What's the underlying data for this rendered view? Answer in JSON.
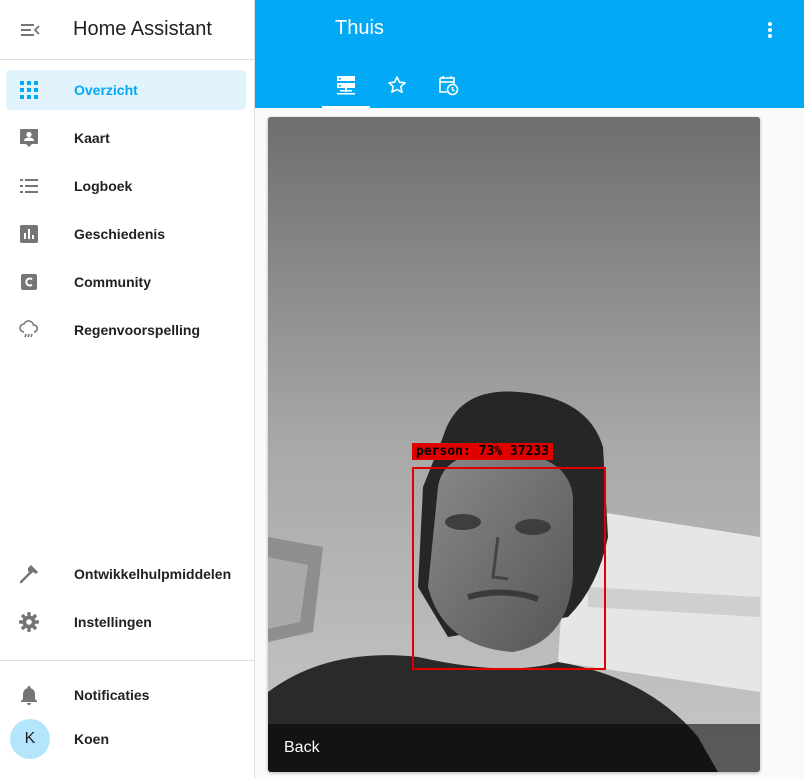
{
  "app": {
    "title": "Home Assistant"
  },
  "sidebar": {
    "items": [
      {
        "label": "Overzicht",
        "icon": "grid-icon",
        "active": true
      },
      {
        "label": "Kaart",
        "icon": "account-box-icon"
      },
      {
        "label": "Logboek",
        "icon": "format-list-icon"
      },
      {
        "label": "Geschiedenis",
        "icon": "chart-bar-icon"
      },
      {
        "label": "Community",
        "icon": "community-c-icon"
      },
      {
        "label": "Regenvoorspelling",
        "icon": "weather-rainy-icon"
      }
    ],
    "bottom_items": [
      {
        "label": "Ontwikkelhulpmiddelen",
        "icon": "hammer-icon"
      },
      {
        "label": "Instellingen",
        "icon": "cog-icon"
      }
    ],
    "notifications": {
      "label": "Notificaties",
      "icon": "bell-icon"
    },
    "user": {
      "initial": "K",
      "name": "Koen"
    }
  },
  "header": {
    "title": "Thuis",
    "tabs": [
      {
        "icon": "view-dashboard-icon",
        "active": true
      },
      {
        "icon": "star-outline-icon"
      },
      {
        "icon": "calendar-clock-icon"
      }
    ]
  },
  "camera_card": {
    "detection_label": "person: 73% 37233",
    "footer": "Back"
  },
  "colors": {
    "primary": "#03a9f4",
    "active_bg": "#e1f3fc",
    "icon": "#757575",
    "detection": "#e00000"
  }
}
